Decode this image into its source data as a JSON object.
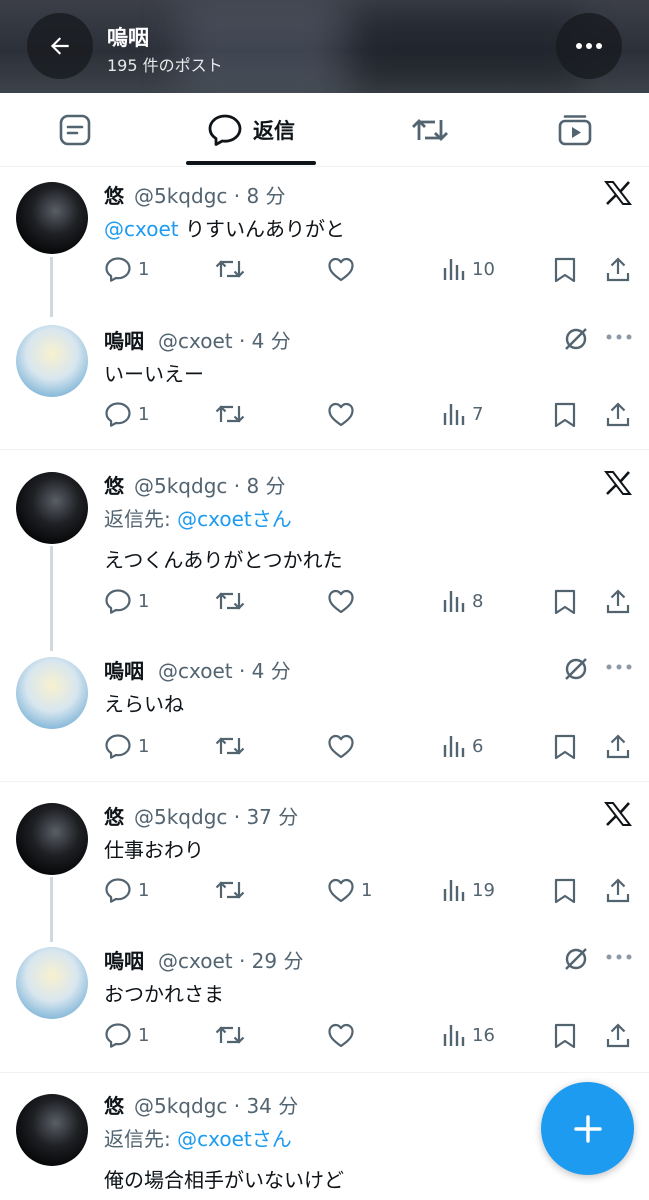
{
  "header": {
    "title": "嗚咽",
    "subtitle": "195 件のポスト"
  },
  "tabs": [
    {
      "icon": "posts-icon",
      "label": ""
    },
    {
      "icon": "reply-bubble-icon",
      "label": "返信"
    },
    {
      "icon": "repost-icon",
      "label": ""
    },
    {
      "icon": "media-icon",
      "label": ""
    }
  ],
  "tweets": [
    {
      "name": "悠",
      "handle": "@5kqdgc · 8 分",
      "mention": "@cxoet",
      "text": " りすいんありがと",
      "replies": "1",
      "likes": "",
      "views": "10",
      "corner": "x-logo-icon"
    },
    {
      "name": "嗚咽",
      "handle": "@cxoet · 4 分",
      "text": "いーいえー",
      "replies": "1",
      "likes": "",
      "views": "7",
      "corner": "mute-icon"
    },
    {
      "name": "悠",
      "handle": "@5kqdgc · 8 分",
      "reply_prefix": "返信先: ",
      "reply_to": "@cxoetさん",
      "text": "えつくんありがとつかれた",
      "replies": "1",
      "likes": "",
      "views": "8",
      "corner": "x-logo-icon"
    },
    {
      "name": "嗚咽",
      "handle": "@cxoet · 4 分",
      "text": "えらいね",
      "replies": "1",
      "likes": "",
      "views": "6",
      "corner": "mute-icon"
    },
    {
      "name": "悠",
      "handle": "@5kqdgc · 37 分",
      "text": "仕事おわり",
      "replies": "1",
      "likes": "1",
      "views": "19",
      "corner": "x-logo-icon"
    },
    {
      "name": "嗚咽",
      "handle": "@cxoet · 29 分",
      "text": "おつかれさま",
      "replies": "1",
      "likes": "",
      "views": "16",
      "corner": "mute-icon"
    },
    {
      "name": "悠",
      "handle": "@5kqdgc · 34 分",
      "reply_prefix": "返信先: ",
      "reply_to": "@cxoetさん",
      "text": "俺の場合相手がいないけど"
    }
  ],
  "colors": {
    "accent": "#1d9bf0",
    "muted": "#536471",
    "text": "#0f1419"
  }
}
